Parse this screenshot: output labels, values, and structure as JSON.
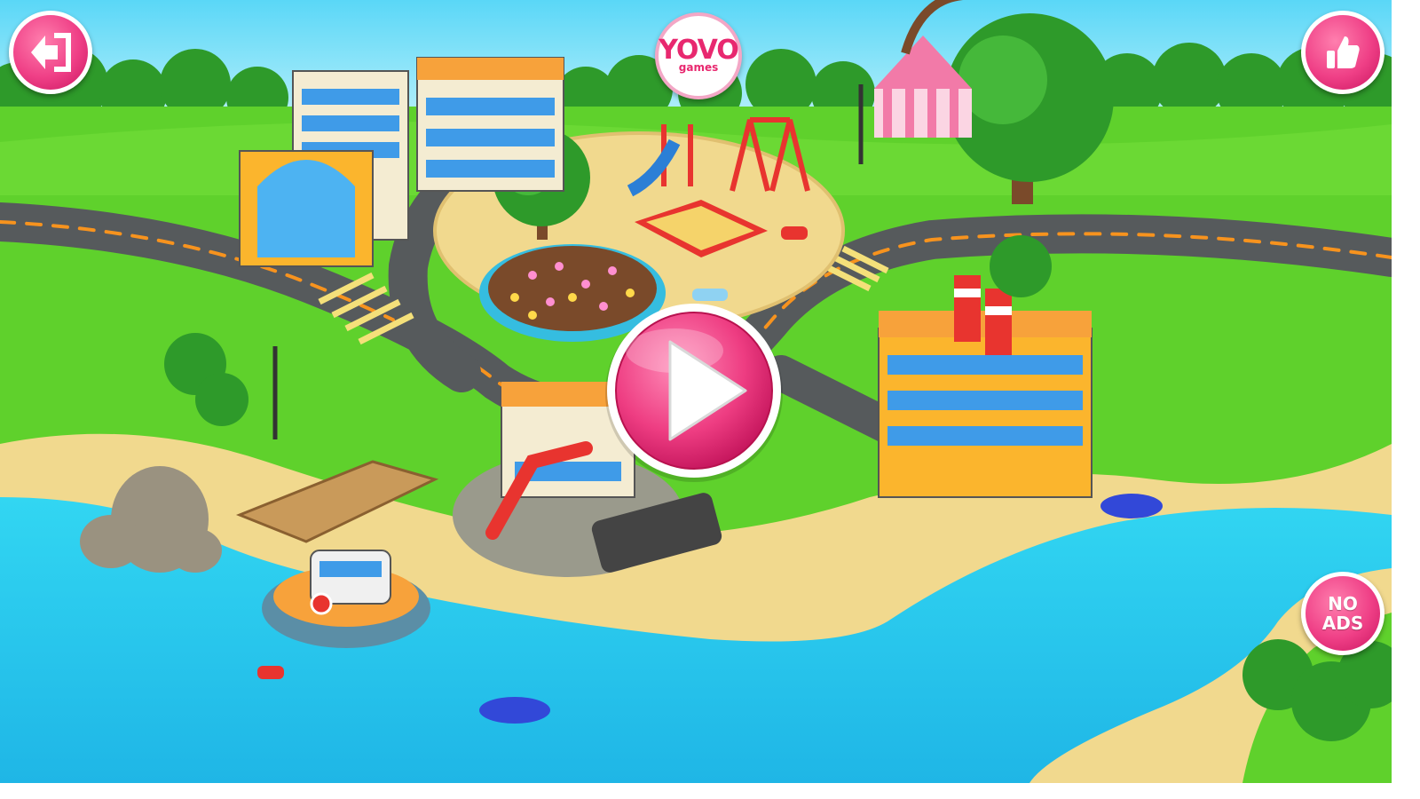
{
  "buttons": {
    "back": {
      "icon": "exit-arrow-icon"
    },
    "like": {
      "icon": "thumbs-up-icon"
    },
    "play": {
      "icon": "play-triangle-icon"
    },
    "no_ads": {
      "line1": "NO",
      "line2": "ADS"
    }
  },
  "logo": {
    "main": "YOVO",
    "sub": "games"
  },
  "colors": {
    "button_pink": "#ef3f86",
    "button_border": "#ffffff",
    "grass": "#5ccf2a",
    "water": "#2cc9ea",
    "road": "#565a5c",
    "sand": "#f1d98e"
  }
}
